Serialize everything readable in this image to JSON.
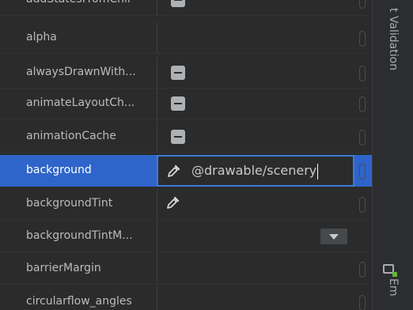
{
  "attributes": [
    {
      "name": "addStatesFromChil",
      "value": "",
      "control": "flag"
    },
    {
      "name": "alpha",
      "value": "",
      "control": "none"
    },
    {
      "name": "alwaysDrawnWith...",
      "value": "",
      "control": "flag"
    },
    {
      "name": "animateLayoutCh...",
      "value": "",
      "control": "flag"
    },
    {
      "name": "animationCache",
      "value": "",
      "control": "flag"
    },
    {
      "name": "background",
      "value": "@drawable/scenery",
      "control": "picker",
      "selected": true
    },
    {
      "name": "backgroundTint",
      "value": "",
      "control": "picker"
    },
    {
      "name": "backgroundTintM...",
      "value": "",
      "control": "dropdown"
    },
    {
      "name": "barrierMargin",
      "value": "",
      "control": "none"
    },
    {
      "name": "circularflow_angles",
      "value": "",
      "control": "none"
    }
  ],
  "side_tabs": {
    "validation": "t Validation",
    "emulator": "Em"
  },
  "colors": {
    "selected_row": "#2f65ca",
    "edit_border": "#3e7bd8",
    "background": "#2b2b2b"
  }
}
